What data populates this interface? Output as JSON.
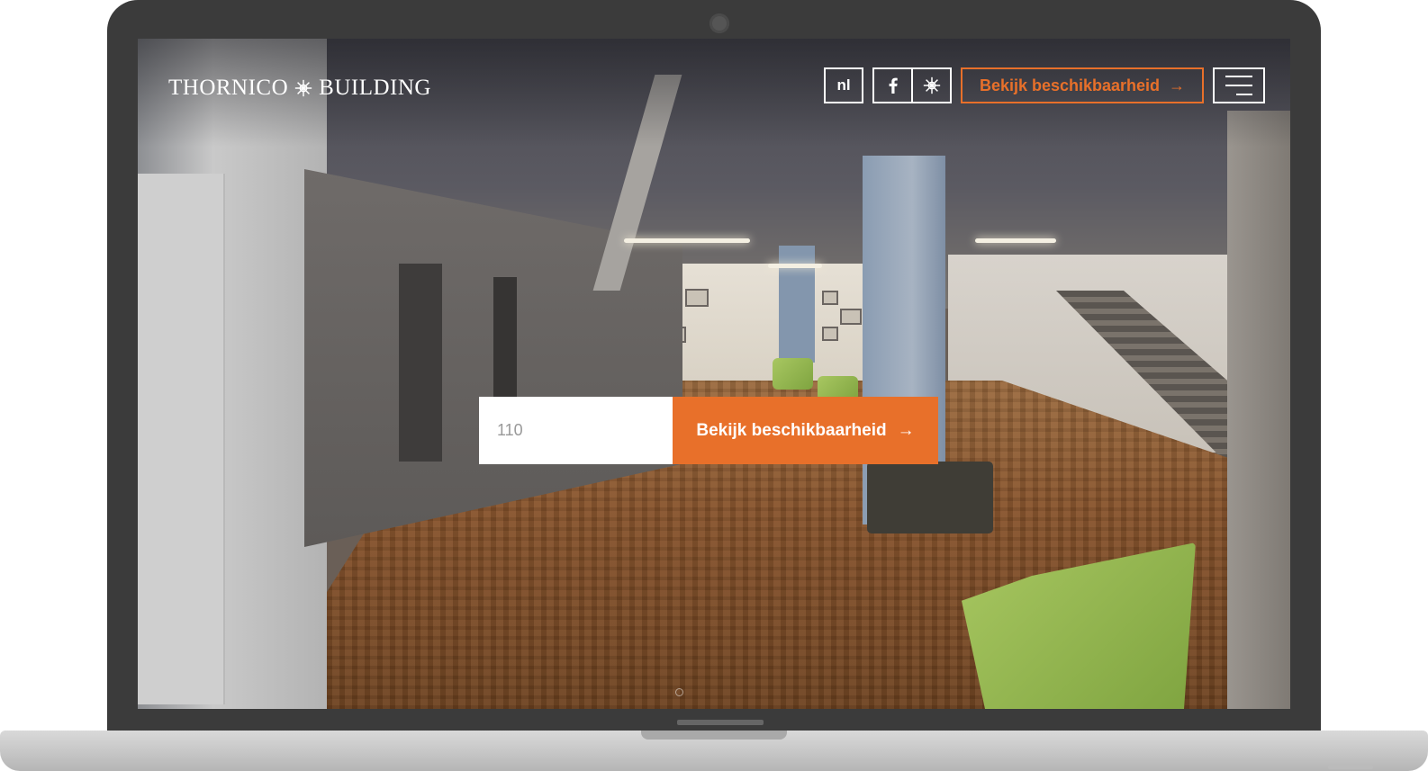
{
  "header": {
    "logo_text_left": "THORNICO",
    "logo_text_right": "BUILDING",
    "logo_icon": "snowflake-emblem-icon",
    "language_label": "nl",
    "social_icons": [
      "facebook-icon",
      "snowflake-emblem-icon"
    ],
    "cta_label": "Bekijk beschikbaarheid",
    "cta_arrow": "→",
    "menu_icon": "hamburger-menu-icon"
  },
  "search": {
    "input_value": "110",
    "button_label": "Bekijk beschikbaarheid",
    "button_arrow": "→"
  },
  "colors": {
    "accent": "#e8702a",
    "header_text": "#ffffff",
    "laptop_frame": "#3b3b3b"
  }
}
